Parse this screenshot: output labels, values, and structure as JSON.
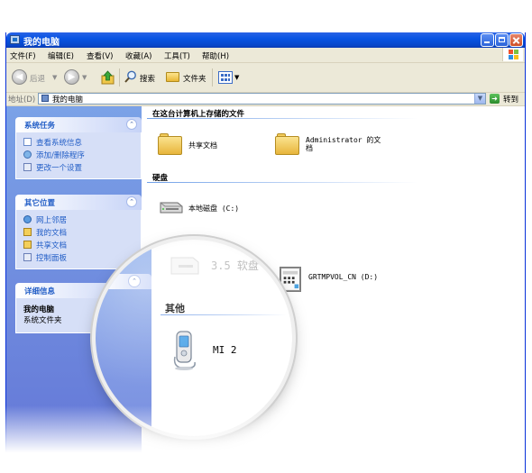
{
  "window": {
    "title": "我的电脑"
  },
  "menubar": {
    "items": [
      "文件(F)",
      "编辑(E)",
      "查看(V)",
      "收藏(A)",
      "工具(T)",
      "帮助(H)"
    ]
  },
  "toolbar": {
    "back_label": "后退",
    "search_label": "搜索",
    "folders_label": "文件夹"
  },
  "address": {
    "label": "地址(D)",
    "value": "我的电脑",
    "go_label": "转到"
  },
  "taskpane": {
    "system_tasks": {
      "title": "系统任务",
      "items": [
        "查看系统信息",
        "添加/删除程序",
        "更改一个设置"
      ]
    },
    "other_places": {
      "title": "其它位置",
      "items": [
        "网上邻居",
        "我的文档",
        "共享文档",
        "控制面板"
      ]
    },
    "details": {
      "title": "详细信息",
      "name": "我的电脑",
      "type": "系统文件夹"
    }
  },
  "content": {
    "files_group": {
      "title": "在这台计算机上存储的文件",
      "items": [
        "共享文档",
        "Administrator 的文档"
      ]
    },
    "drives_group": {
      "title": "硬盘",
      "items": [
        "本地磁盘 (C:)"
      ]
    },
    "removable": {
      "floppy": "3.5 软盘",
      "cd": "GRTMPVOL_CN (D:)"
    },
    "other_group": {
      "title": "其他",
      "items": [
        "MI 2"
      ]
    }
  },
  "colors": {
    "titlebar": "#0854e3",
    "taskpane": "#7ba2e7",
    "link": "#215dc6"
  }
}
